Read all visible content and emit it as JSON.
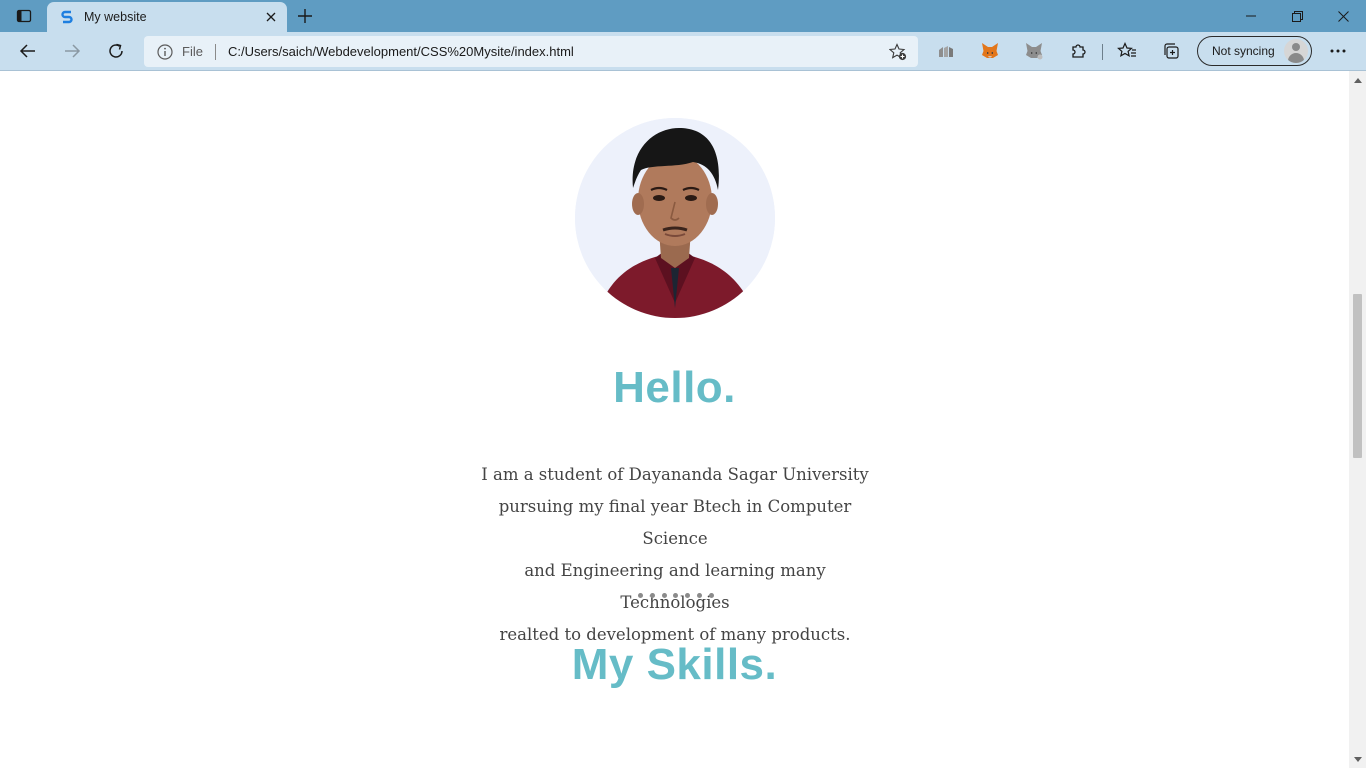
{
  "browser": {
    "tab": {
      "title": "My website",
      "favicon": "S-favicon-icon"
    },
    "new_tab_icon": "plus-icon",
    "window_controls": [
      "minimize-icon",
      "restore-icon",
      "close-icon"
    ],
    "address": {
      "scheme_label": "File",
      "url": "C:/Users/saich/Webdevelopment/CSS%20Mysite/index.html"
    },
    "sync": {
      "label": "Not syncing"
    },
    "extensions": [
      "extension-chart-icon",
      "metamask-fox-icon",
      "grey-fox-icon",
      "puzzle-extensions-icon"
    ],
    "accent": "#5f9cc2"
  },
  "page": {
    "profile_alt": "",
    "hello_heading": "Hello.",
    "bio_lines": [
      "I am a student of Dayananda Sagar University",
      "pursuing my final year Btech in Computer Science",
      "and Engineering and learning many Technologies",
      "realted to development of many products."
    ],
    "dots_count": 7,
    "skills_heading": "My Skills.",
    "heading_color": "#66bcc7"
  }
}
